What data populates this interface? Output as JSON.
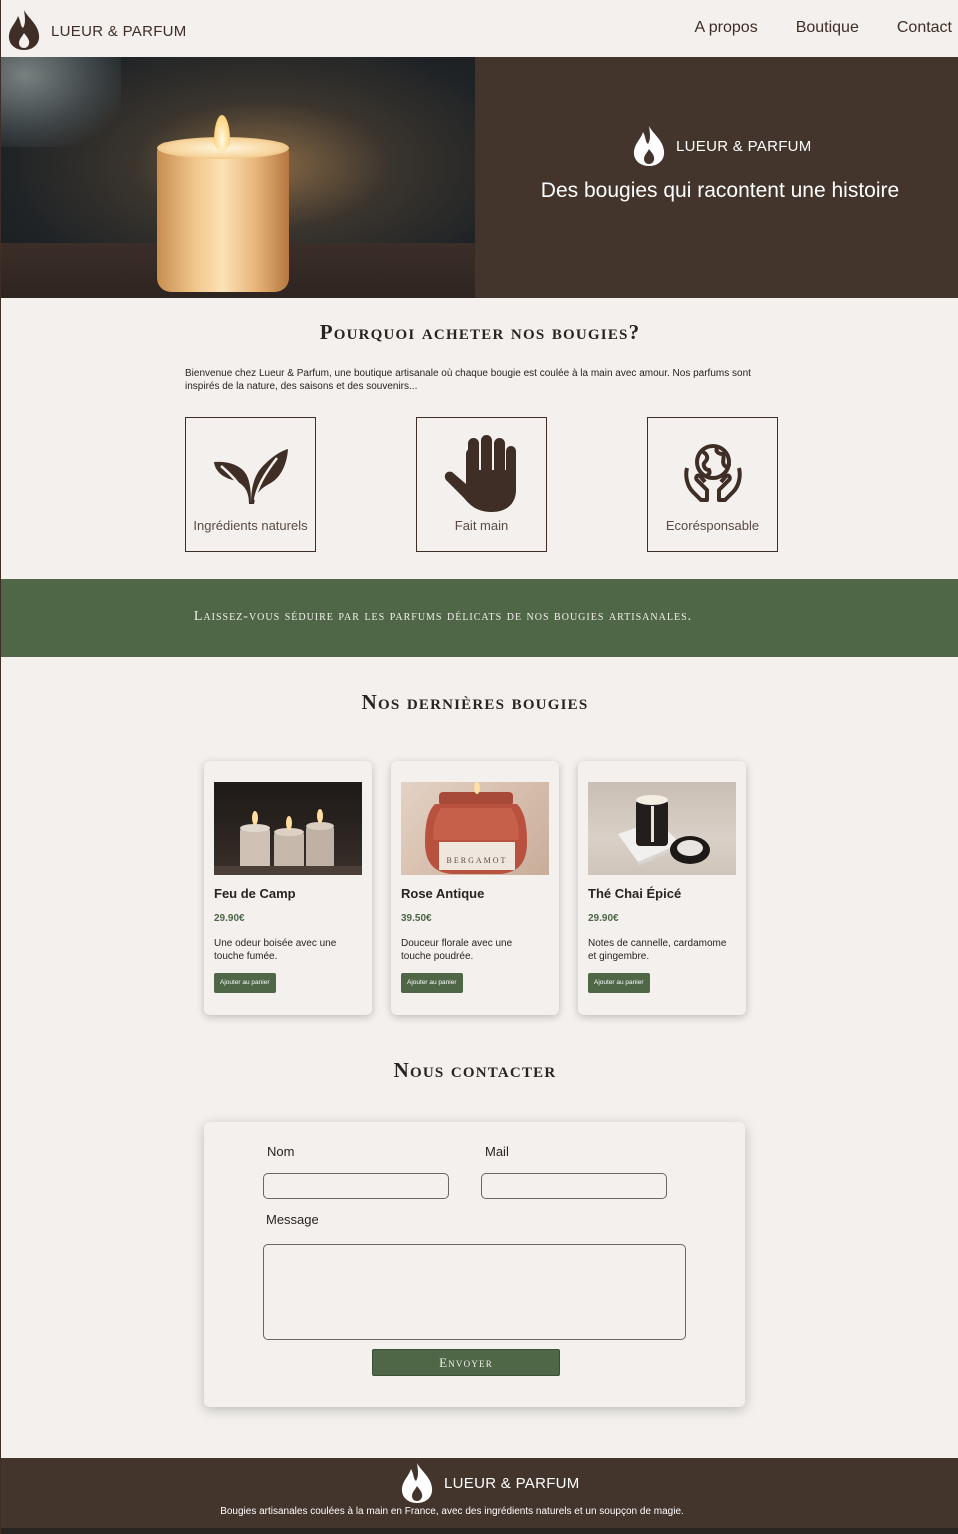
{
  "header": {
    "brand": "LUEUR & PARFUM",
    "nav": [
      {
        "label": "A propos"
      },
      {
        "label": "Boutique"
      },
      {
        "label": "Contact"
      }
    ]
  },
  "hero": {
    "brand": "LUEUR & PARFUM",
    "tagline": "Des bougies qui racontent une histoire"
  },
  "why": {
    "title": "Pourquoi acheter nos bougies?",
    "intro": "Bienvenue chez Lueur & Parfum, une boutique artisanale où chaque bougie est coulée à la main avec amour. Nos parfums sont inspirés de la nature, des saisons et des souvenirs...",
    "features": [
      {
        "label": "Ingrédients naturels",
        "icon": "leaf-icon"
      },
      {
        "label": "Fait main",
        "icon": "hand-icon"
      },
      {
        "label": "Ecorésponsable",
        "icon": "earth-hands-icon"
      }
    ]
  },
  "banner": {
    "text": "Laissez-vous séduire par les parfums délicats de nos bougies artisanales."
  },
  "products": {
    "title": "Nos dernières bougies",
    "items": [
      {
        "name": "Feu de Camp",
        "price": "29.90€",
        "desc": "Une odeur boisée avec une touche fumée.",
        "button": "Ajouter au panier"
      },
      {
        "name": "Rose Antique",
        "price": "39.50€",
        "desc": "Douceur florale avec une touche poudrée.",
        "button": "Ajouter au panier",
        "jar_label": "BERGAMOT"
      },
      {
        "name": "Thé Chai Épicé",
        "price": "29.90€",
        "desc": "Notes de cannelle, cardamome et gingembre.",
        "button": "Ajouter au panier"
      }
    ]
  },
  "contact": {
    "title": "Nous contacter",
    "name_label": "Nom",
    "mail_label": "Mail",
    "message_label": "Message",
    "submit": "Envoyer"
  },
  "footer": {
    "brand": "LUEUR & PARFUM",
    "text": "Bougies artisanales coulées à la main en France, avec des ingrédients naturels et un soupçon de magie."
  },
  "colors": {
    "background": "#f3f0ed",
    "brown": "#43342c",
    "green": "#4f6647"
  }
}
